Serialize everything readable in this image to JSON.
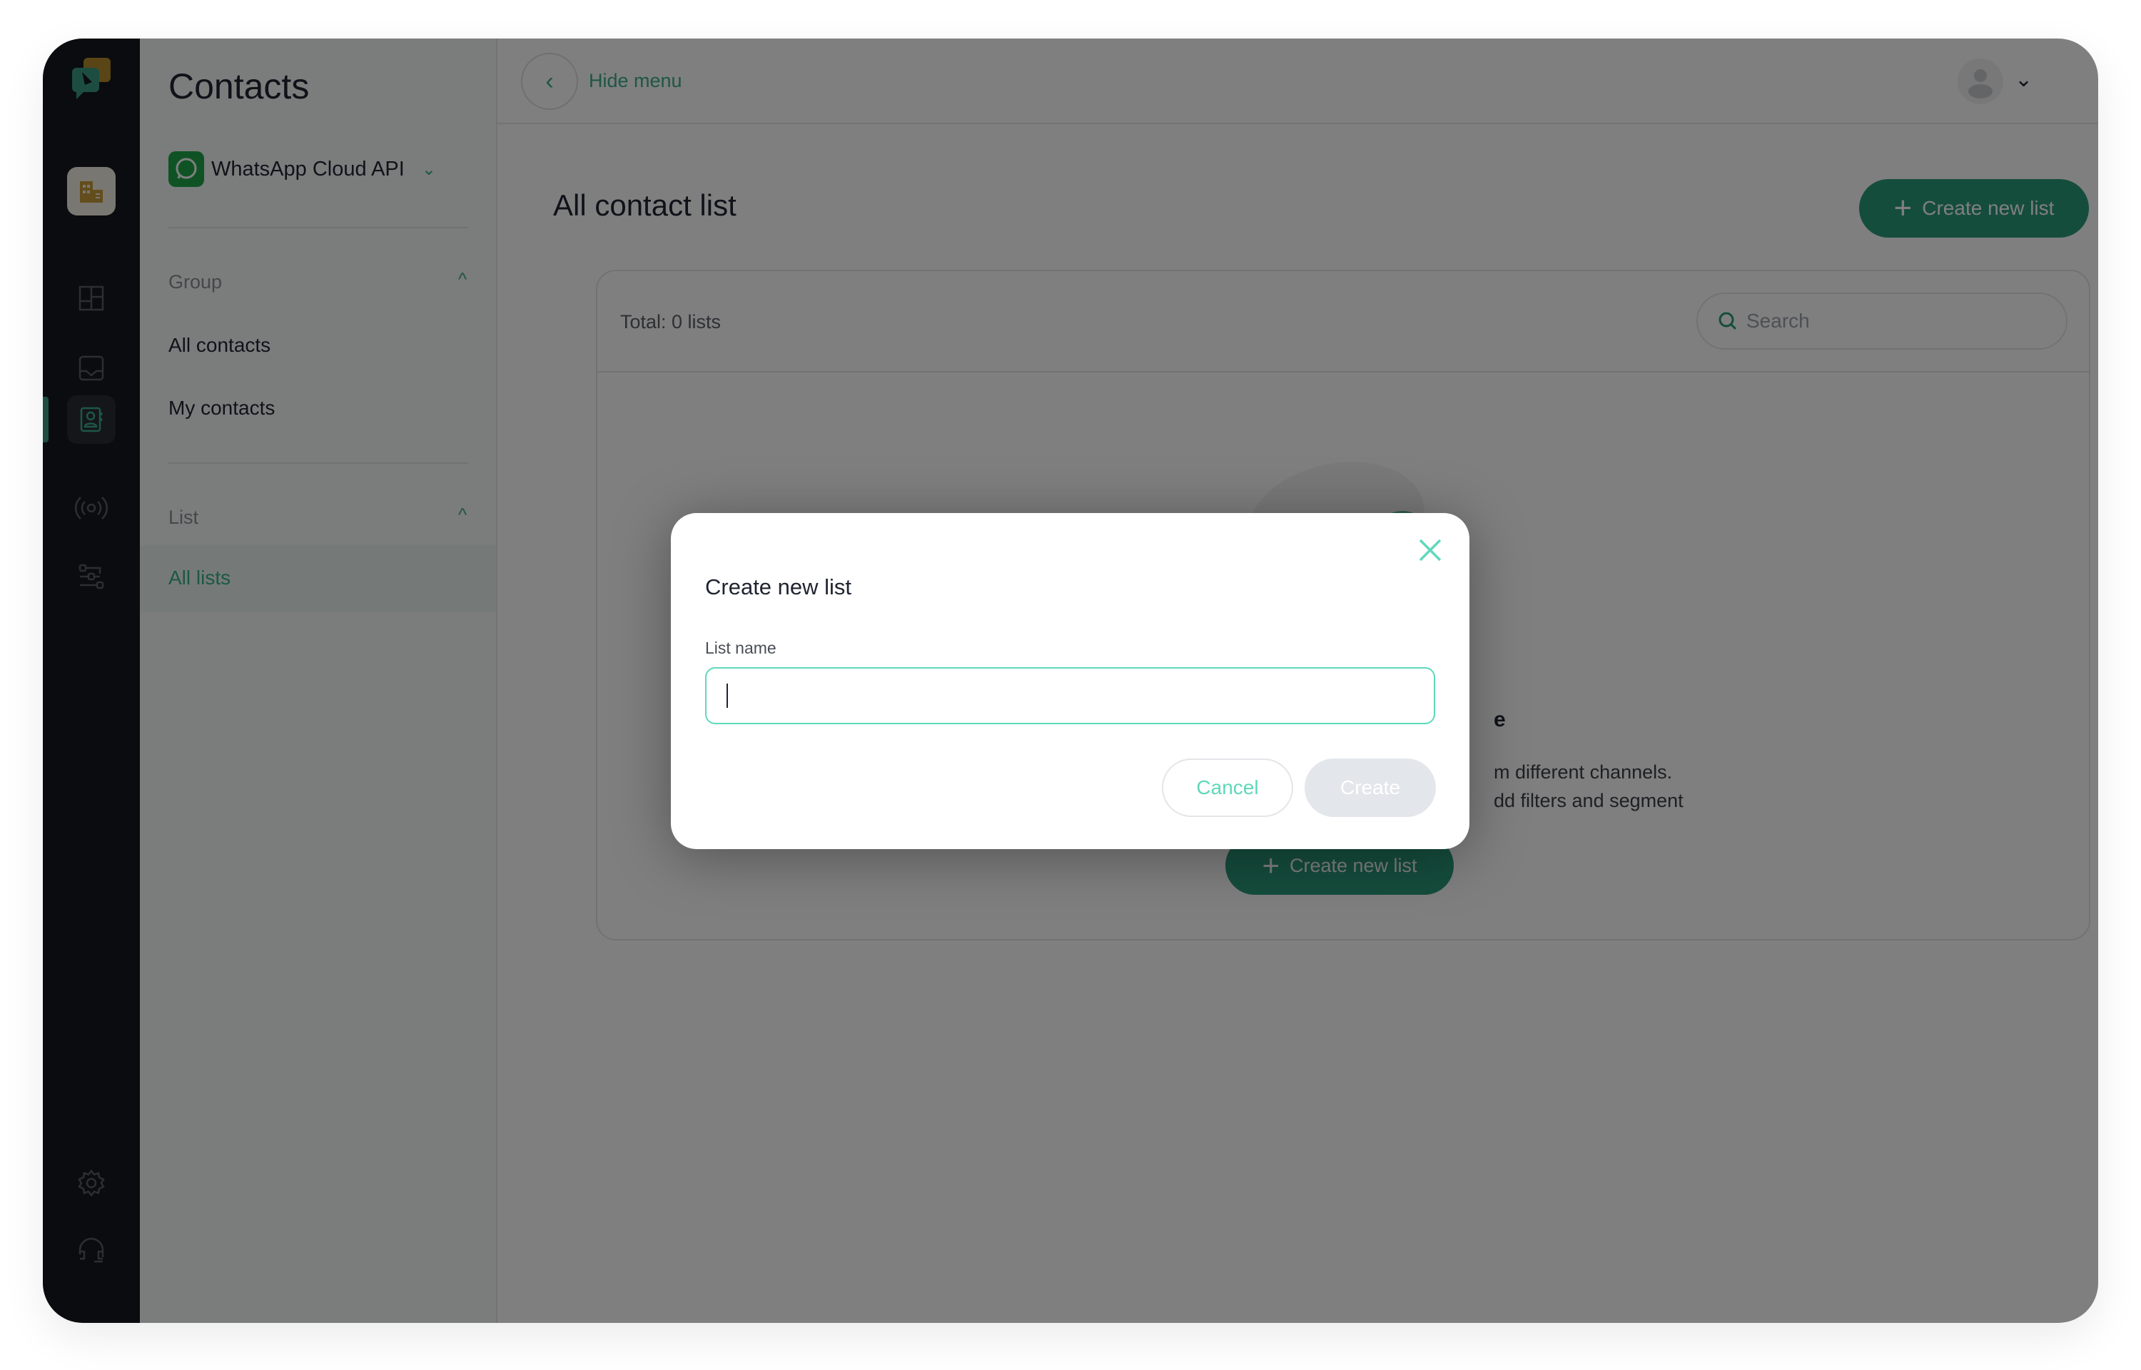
{
  "sidebar": {
    "title": "Contacts",
    "channel": "WhatsApp Cloud API",
    "group_label": "Group",
    "group_items": [
      "All contacts",
      "My contacts"
    ],
    "list_label": "List",
    "list_items": [
      "All lists"
    ]
  },
  "header": {
    "hide_menu": "Hide menu"
  },
  "main": {
    "title": "All contact list",
    "create_button": "Create new list",
    "total": "Total: 0 lists",
    "search_placeholder": "Search",
    "empty_fragments": [
      "e",
      "m different channels.",
      "dd filters and segment"
    ],
    "empty_button": "Create new list"
  },
  "modal": {
    "title": "Create new list",
    "field_label": "List name",
    "field_value": "",
    "cancel": "Cancel",
    "create": "Create"
  },
  "colors": {
    "accent": "#5fd8bb",
    "brand_green": "#2b9b7b",
    "rail": "#16181f"
  }
}
